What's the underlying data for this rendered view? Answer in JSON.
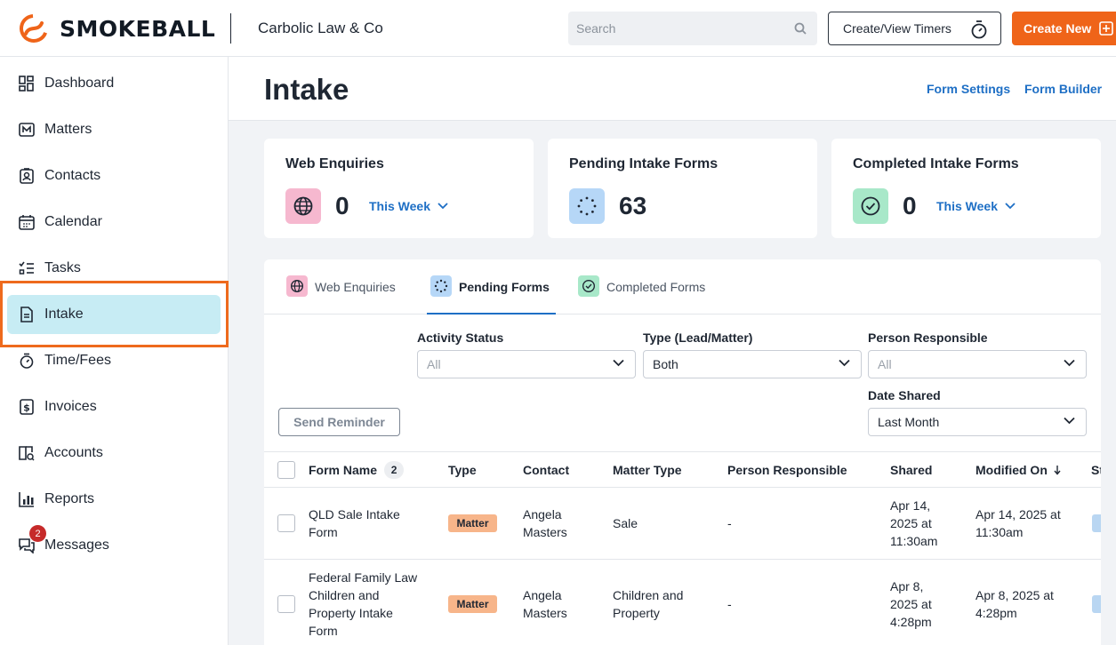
{
  "header": {
    "brand": "SMOKEBALL",
    "firm_name": "Carbolic Law & Co",
    "search_placeholder": "Search",
    "timers_label": "Create/View Timers",
    "create_label": "Create New"
  },
  "sidebar": {
    "items": [
      {
        "label": "Dashboard",
        "icon": "dashboard-icon"
      },
      {
        "label": "Matters",
        "icon": "matters-icon"
      },
      {
        "label": "Contacts",
        "icon": "contacts-icon"
      },
      {
        "label": "Calendar",
        "icon": "calendar-icon"
      },
      {
        "label": "Tasks",
        "icon": "tasks-icon"
      },
      {
        "label": "Intake",
        "icon": "intake-icon",
        "active": true
      },
      {
        "label": "Time/Fees",
        "icon": "stopwatch-icon"
      },
      {
        "label": "Invoices",
        "icon": "invoice-icon"
      },
      {
        "label": "Accounts",
        "icon": "accounts-icon"
      },
      {
        "label": "Reports",
        "icon": "reports-icon"
      },
      {
        "label": "Messages",
        "icon": "messages-icon",
        "badge": "2"
      }
    ]
  },
  "page": {
    "title": "Intake",
    "links": [
      "Form Settings",
      "Form Builder"
    ]
  },
  "cards": [
    {
      "title": "Web Enquiries",
      "value": "0",
      "period": "This Week",
      "icon": "globe-icon",
      "color": "#f6b8cf"
    },
    {
      "title": "Pending Intake Forms",
      "value": "63",
      "icon": "pending-icon",
      "color": "#b6d7f7"
    },
    {
      "title": "Completed Intake Forms",
      "value": "0",
      "period": "This Week",
      "icon": "check-circle-icon",
      "color": "#a8e8c9"
    }
  ],
  "tabs": [
    {
      "label": "Web Enquiries",
      "icon": "globe-icon"
    },
    {
      "label": "Pending Forms",
      "icon": "pending-icon",
      "active": true
    },
    {
      "label": "Completed Forms",
      "icon": "check-circle-icon"
    }
  ],
  "filters": {
    "activity_status": {
      "label": "Activity Status",
      "value": "All"
    },
    "type": {
      "label": "Type (Lead/Matter)",
      "value": "Both"
    },
    "person": {
      "label": "Person Responsible",
      "value": "All"
    },
    "date_shared": {
      "label": "Date Shared",
      "value": "Last Month"
    }
  },
  "send_reminder_label": "Send Reminder",
  "table": {
    "columns": [
      "Form Name",
      "Type",
      "Contact",
      "Matter Type",
      "Person Responsible",
      "Shared",
      "Modified On",
      "St"
    ],
    "form_count": "2",
    "rows": [
      {
        "form_name": [
          "QLD Sale Intake",
          "Form"
        ],
        "type": "Matter",
        "contact": [
          "Angela",
          "Masters"
        ],
        "matter_type": [
          "Sale"
        ],
        "person": "-",
        "shared": [
          "Apr 14,",
          "2025 at",
          "11:30am"
        ],
        "modified": [
          "Apr 14, 2025 at",
          "11:30am"
        ]
      },
      {
        "form_name": [
          "Federal Family Law",
          "Children and",
          "Property Intake",
          "Form"
        ],
        "type": "Matter",
        "contact": [
          "Angela",
          "Masters"
        ],
        "matter_type": [
          "Children and",
          "Property"
        ],
        "person": "-",
        "shared": [
          "Apr 8,",
          "2025 at",
          "4:28pm"
        ],
        "modified": [
          "Apr 8, 2025 at",
          "4:28pm"
        ]
      }
    ]
  },
  "colors": {
    "accent": "#ef6419",
    "link": "#1e6fc5",
    "active_nav": "#c7ecf4"
  }
}
